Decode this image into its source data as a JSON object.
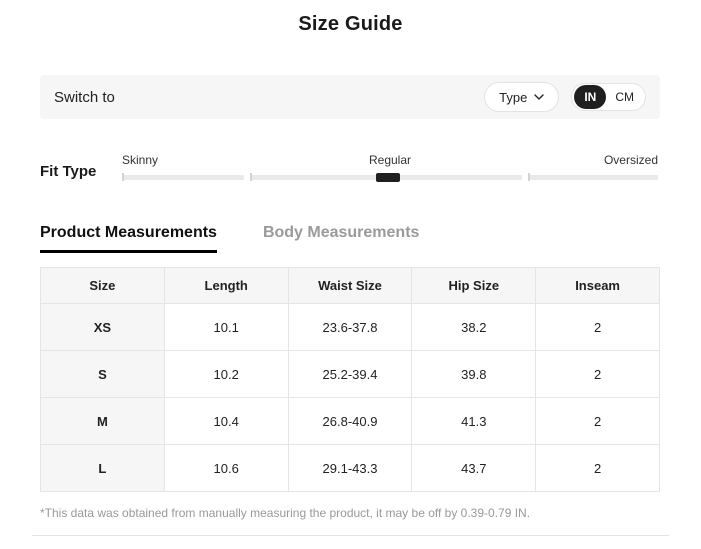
{
  "title": "Size Guide",
  "switch_bar": {
    "label": "Switch to",
    "type_dropdown": {
      "label": "Type"
    },
    "unit_toggle": {
      "selected": "IN",
      "options": [
        "IN",
        "CM"
      ]
    }
  },
  "fit_type": {
    "label": "Fit Type",
    "options": [
      "Skinny",
      "Regular",
      "Oversized"
    ],
    "selected": "Regular"
  },
  "tabs": [
    {
      "label": "Product Measurements",
      "active": true
    },
    {
      "label": "Body Measurements",
      "active": false
    }
  ],
  "table": {
    "headers": [
      "Size",
      "Length",
      "Waist Size",
      "Hip Size",
      "Inseam"
    ],
    "rows": [
      [
        "XS",
        "10.1",
        "23.6-37.8",
        "38.2",
        "2"
      ],
      [
        "S",
        "10.2",
        "25.2-39.4",
        "39.8",
        "2"
      ],
      [
        "M",
        "10.4",
        "26.8-40.9",
        "41.3",
        "2"
      ],
      [
        "L",
        "10.6",
        "29.1-43.3",
        "43.7",
        "2"
      ]
    ]
  },
  "footnote": "*This data was obtained from manually measuring the product, it may be off by 0.39-0.79 IN.",
  "colors": {
    "accent_dark": "#1f1f1f",
    "bar_background": "#f6f6f6",
    "border": "#e5e5e5",
    "muted_text": "#999999"
  }
}
